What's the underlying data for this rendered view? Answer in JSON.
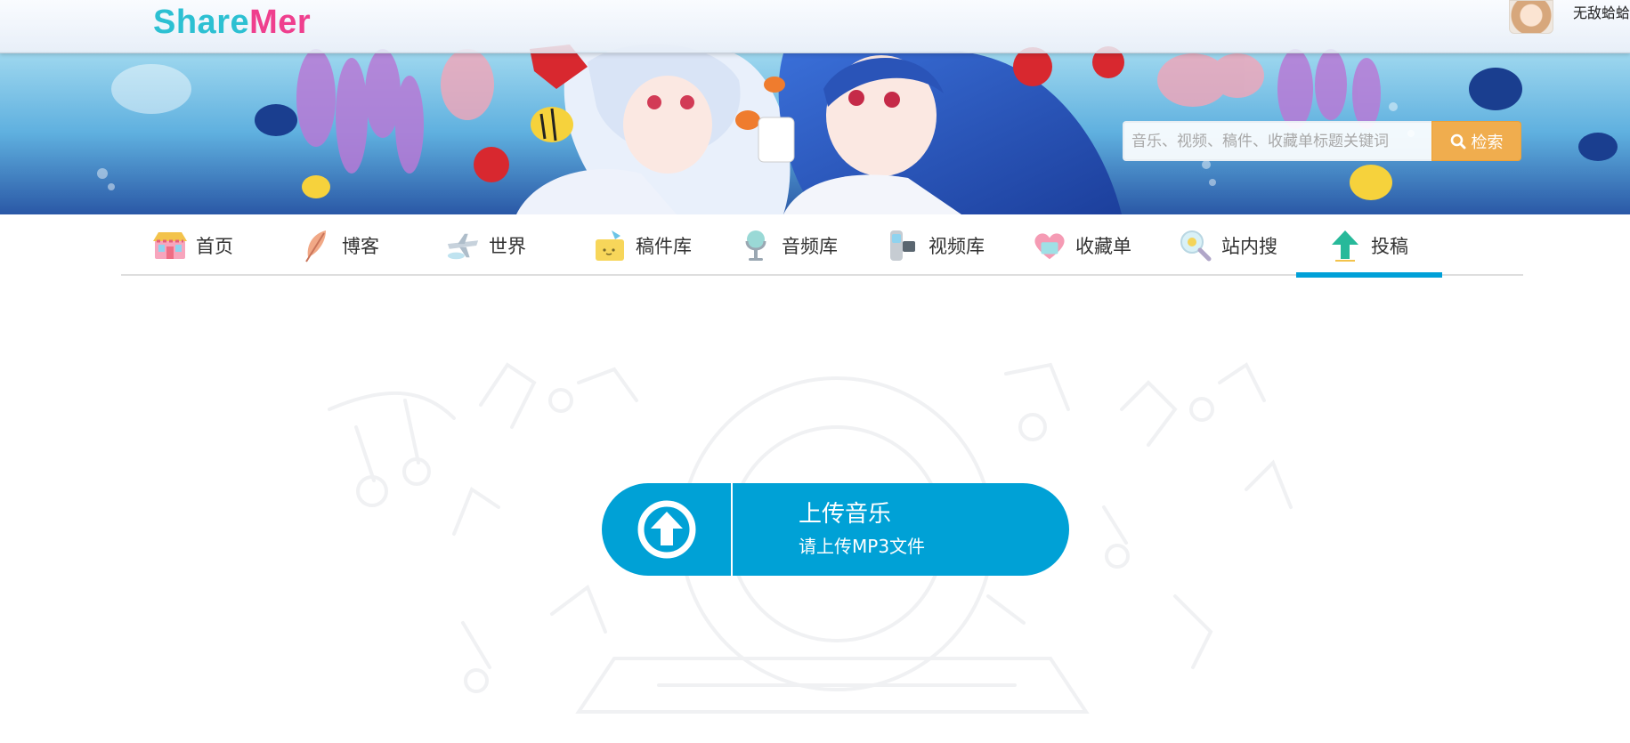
{
  "header": {
    "logo_part1": "Share",
    "logo_part2": "Mer",
    "username": "无敌蛤蛤",
    "search_placeholder": "音乐、视频、稿件、收藏单标题关键词",
    "search_button": "检索"
  },
  "nav": {
    "items": [
      {
        "label": "首页",
        "icon": "home-icon"
      },
      {
        "label": "博客",
        "icon": "feather-icon"
      },
      {
        "label": "世界",
        "icon": "airplane-icon"
      },
      {
        "label": "稿件库",
        "icon": "folder-icon"
      },
      {
        "label": "音频库",
        "icon": "microphone-icon"
      },
      {
        "label": "视频库",
        "icon": "video-icon"
      },
      {
        "label": "收藏单",
        "icon": "heart-icon"
      },
      {
        "label": "站内搜",
        "icon": "magnifier-icon"
      },
      {
        "label": "投稿",
        "icon": "upload-arrow-icon"
      }
    ],
    "active": "投稿"
  },
  "upload": {
    "title": "上传音乐",
    "subtitle": "请上传MP3文件"
  },
  "colors": {
    "accent": "#00a1d6",
    "search_button": "#f0ad4e",
    "logo_share": "#2cc0d2",
    "logo_mer": "#ef3f8e"
  }
}
